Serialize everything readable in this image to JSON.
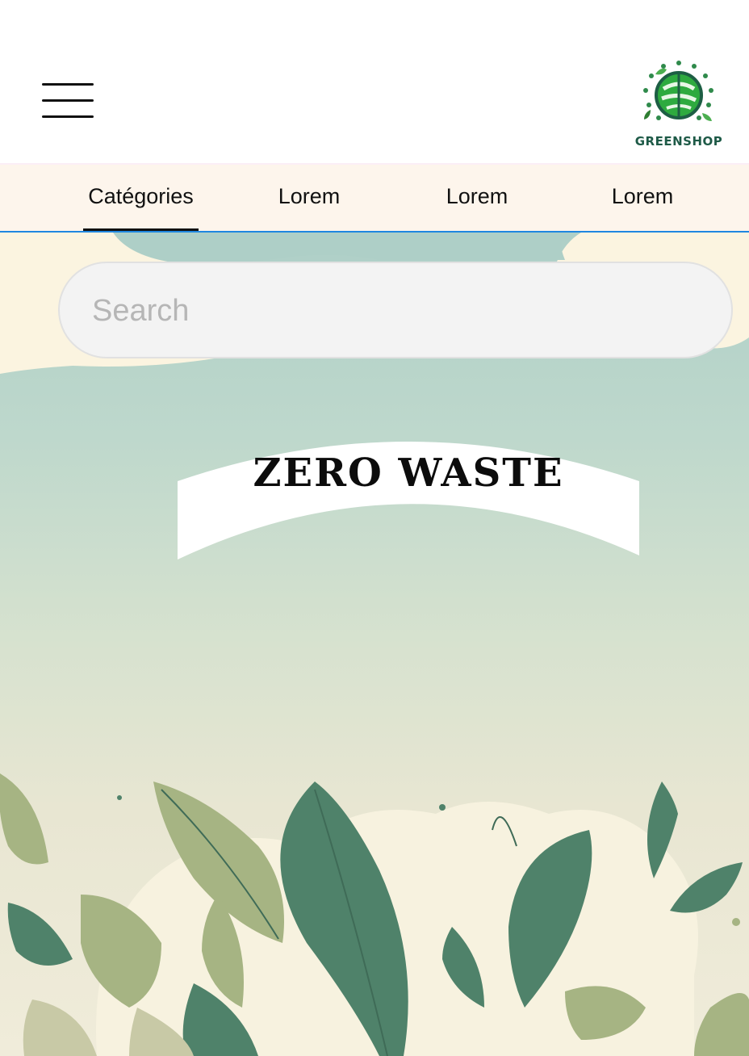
{
  "header": {
    "logo_text": "GREENSHOP"
  },
  "nav": {
    "tabs": [
      {
        "label": "Catégories",
        "active": true
      },
      {
        "label": "Lorem",
        "active": false
      },
      {
        "label": "Lorem",
        "active": false
      },
      {
        "label": "Lorem",
        "active": false
      }
    ]
  },
  "search": {
    "placeholder": "Search",
    "value": ""
  },
  "hero": {
    "banner_title": "ZERO WASTE"
  },
  "colors": {
    "tab_bar_bg": "#fdf5ec",
    "tab_underline": "#1f87e0",
    "leaf_dark": "#4f826a",
    "leaf_light": "#9fb27e",
    "logo_green": "#2ea043"
  },
  "icons": [
    "hamburger-menu-icon",
    "globe-recycle-logo"
  ]
}
